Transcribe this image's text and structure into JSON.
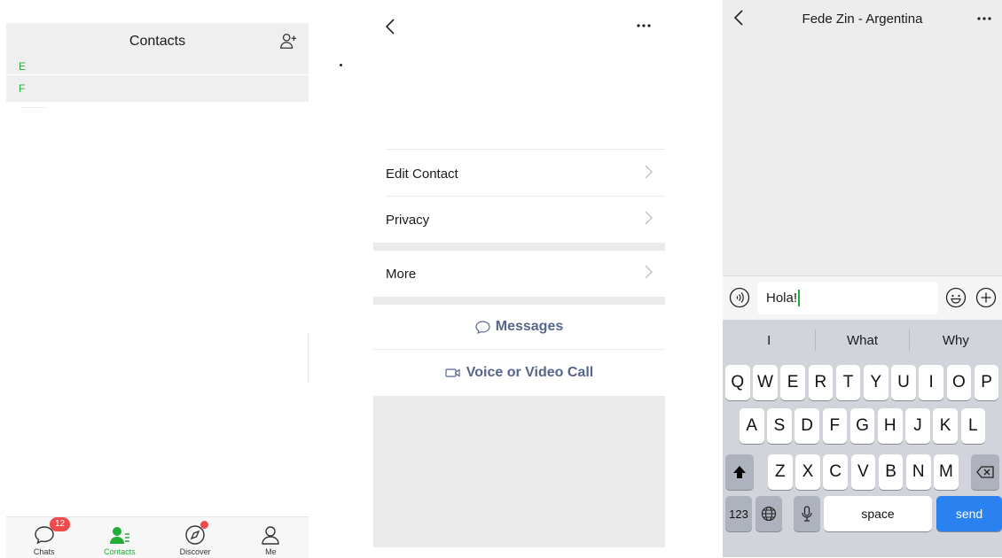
{
  "contacts": {
    "title": "Contacts",
    "index_letters": [
      "E",
      "F"
    ],
    "tabs": [
      {
        "label": "Chats",
        "badge": "12"
      },
      {
        "label": "Contacts"
      },
      {
        "label": "Discover"
      },
      {
        "label": "Me"
      }
    ],
    "accent_color": "#22ac38"
  },
  "profile": {
    "rows": [
      {
        "label": "Edit Contact"
      },
      {
        "label": "Privacy"
      },
      {
        "label": "More"
      }
    ],
    "actions": {
      "messages": "Messages",
      "call": "Voice or Video Call"
    },
    "action_color": "#56668c"
  },
  "chat": {
    "title": "Fede Zin - Argentina",
    "input_value": "Hola!",
    "suggestions": [
      "I",
      "What",
      "Why"
    ],
    "keyboard": {
      "row1": [
        "Q",
        "W",
        "E",
        "R",
        "T",
        "Y",
        "U",
        "I",
        "O",
        "P"
      ],
      "row2": [
        "A",
        "S",
        "D",
        "F",
        "G",
        "H",
        "J",
        "K",
        "L"
      ],
      "row3": [
        "Z",
        "X",
        "C",
        "V",
        "B",
        "N",
        "M"
      ],
      "numbers": "123",
      "space": "space",
      "send": "send"
    },
    "send_color": "#2a82f0"
  }
}
